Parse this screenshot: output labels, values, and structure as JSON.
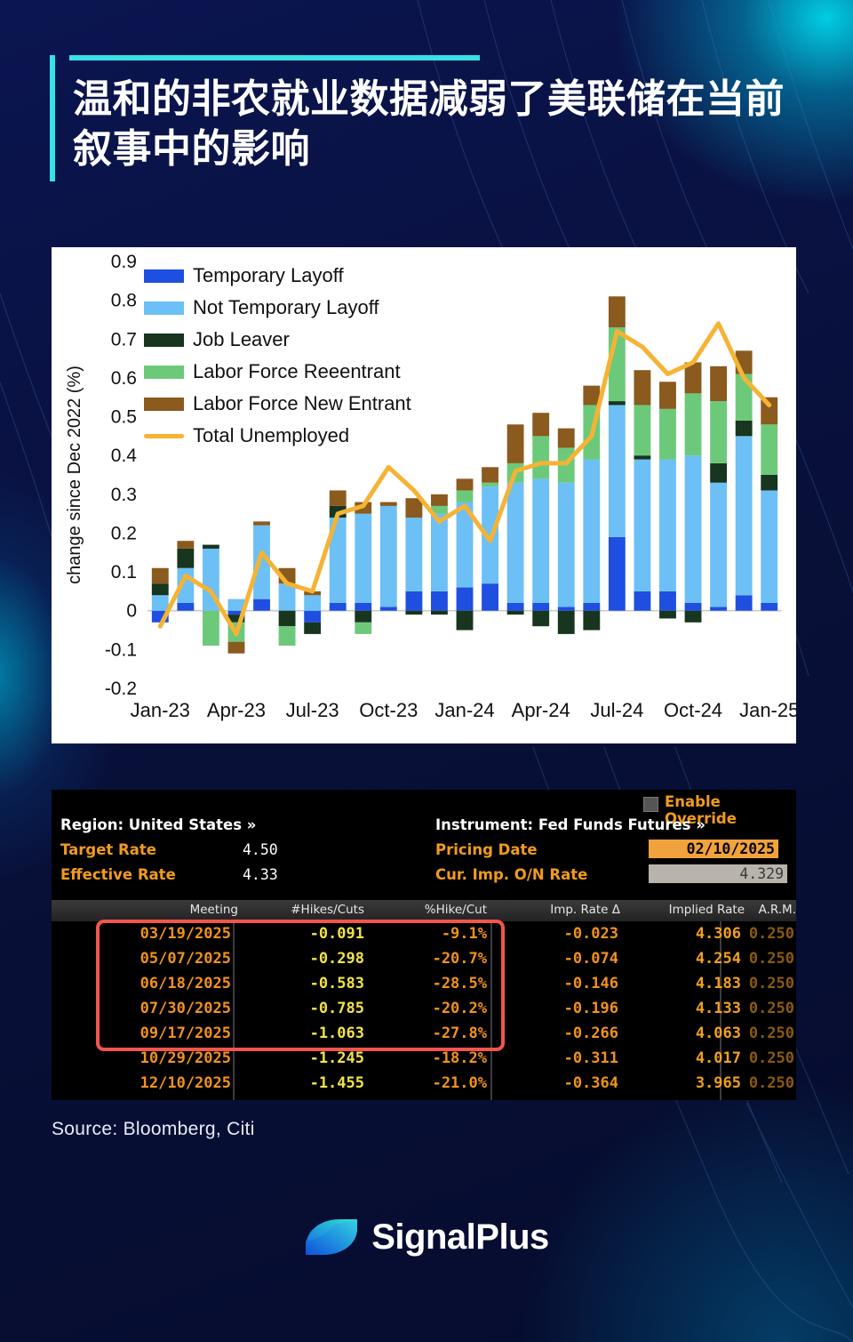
{
  "meta": {
    "brand": "SignalPlus",
    "accent_cyan": "#35e2e8",
    "bg_navy": "#0a1347"
  },
  "header": {
    "title": "温和的非农就业数据减弱了美联储在当前叙事中的影响"
  },
  "footer": {
    "source": "Source: Bloomberg, Citi",
    "logo_text": "SignalPlus"
  },
  "chart_data": {
    "type": "bar",
    "title": "",
    "xlabel": "",
    "ylabel": "change since Dec 2022 (%)",
    "ylim": [
      -0.2,
      0.9
    ],
    "ytick_labels": [
      "0.9",
      "0.8",
      "0.7",
      "0.6",
      "0.5",
      "0.4",
      "0.3",
      "0.2",
      "0.1",
      "0",
      "-0.1",
      "-0.2"
    ],
    "ytick_values": [
      0.9,
      0.8,
      0.7,
      0.6,
      0.5,
      0.4,
      0.3,
      0.2,
      0.1,
      0,
      -0.1,
      -0.2
    ],
    "grid": false,
    "stacked": true,
    "legend_position": "top-left",
    "xtick_labels": [
      "Jan-23",
      "Apr-23",
      "Jul-23",
      "Oct-23",
      "Jan-24",
      "Apr-24",
      "Jul-24",
      "Oct-24",
      "Jan-25"
    ],
    "xtick_indices": [
      0,
      3,
      6,
      9,
      12,
      15,
      18,
      21,
      24
    ],
    "categories": [
      "Jan-23",
      "Feb-23",
      "Mar-23",
      "Apr-23",
      "May-23",
      "Jun-23",
      "Jul-23",
      "Aug-23",
      "Sep-23",
      "Oct-23",
      "Nov-23",
      "Dec-23",
      "Jan-24",
      "Feb-24",
      "Mar-24",
      "Apr-24",
      "May-24",
      "Jun-24",
      "Jul-24",
      "Aug-24",
      "Sep-24",
      "Oct-24",
      "Nov-24",
      "Dec-24",
      "Jan-25"
    ],
    "colors": {
      "Temporary Layoff": "#1f4fe0",
      "Not Temporary Layoff": "#6cc0f5",
      "Job Leaver": "#17351f",
      "Labor Force Reeentrant": "#6dc97a",
      "Labor Force New Entrant": "#8a5a1e",
      "Total Unemployed": "#f5b335"
    },
    "series": [
      {
        "name": "Temporary Layoff",
        "values": [
          -0.03,
          0.02,
          0.0,
          -0.01,
          0.03,
          0.0,
          -0.03,
          0.02,
          0.02,
          0.01,
          0.05,
          0.05,
          0.06,
          0.07,
          0.02,
          0.02,
          0.01,
          0.02,
          0.19,
          0.05,
          0.05,
          0.02,
          0.01,
          0.04,
          0.02
        ]
      },
      {
        "name": "Not Temporary Layoff",
        "values": [
          0.04,
          0.09,
          0.16,
          0.03,
          0.19,
          0.07,
          0.04,
          0.22,
          0.23,
          0.26,
          0.19,
          0.2,
          0.22,
          0.25,
          0.31,
          0.32,
          0.32,
          0.37,
          0.34,
          0.34,
          0.34,
          0.38,
          0.32,
          0.41,
          0.29
        ]
      },
      {
        "name": "Job Leaver",
        "values": [
          0.03,
          0.05,
          0.01,
          -0.02,
          0.0,
          -0.04,
          -0.03,
          0.03,
          -0.03,
          0.0,
          -0.01,
          -0.01,
          -0.05,
          0.0,
          -0.01,
          -0.04,
          -0.06,
          -0.05,
          0.01,
          0.01,
          -0.02,
          -0.03,
          0.05,
          0.04,
          0.04
        ]
      },
      {
        "name": "Labor Force Reeentrant",
        "values": [
          0.0,
          0.0,
          -0.09,
          -0.05,
          0.0,
          -0.05,
          0.0,
          0.0,
          -0.03,
          0.0,
          0.0,
          0.02,
          0.03,
          0.01,
          0.05,
          0.11,
          0.09,
          0.14,
          0.19,
          0.13,
          0.13,
          0.16,
          0.16,
          0.12,
          0.13
        ]
      },
      {
        "name": "Labor Force New Entrant",
        "values": [
          0.04,
          0.02,
          0.0,
          -0.03,
          0.01,
          0.04,
          0.01,
          0.04,
          0.03,
          0.01,
          0.05,
          0.03,
          0.03,
          0.04,
          0.1,
          0.06,
          0.05,
          0.05,
          0.08,
          0.09,
          0.07,
          0.08,
          0.09,
          0.06,
          0.07
        ]
      }
    ],
    "line_series": {
      "name": "Total Unemployed",
      "values": [
        -0.04,
        0.09,
        0.05,
        -0.06,
        0.15,
        0.07,
        0.05,
        0.25,
        0.27,
        0.37,
        0.31,
        0.23,
        0.27,
        0.18,
        0.36,
        0.38,
        0.38,
        0.45,
        0.72,
        0.68,
        0.61,
        0.64,
        0.74,
        0.6,
        0.53
      ]
    }
  },
  "terminal": {
    "enable_override_label": "Enable Override",
    "region_label": "Region: United States »",
    "instrument_label": "Instrument: Fed Funds Futures »",
    "target_rate_label": "Target Rate",
    "target_rate_value": "4.50",
    "effective_rate_label": "Effective Rate",
    "effective_rate_value": "4.33",
    "pricing_date_label": "Pricing Date",
    "pricing_date_value": "02/10/2025",
    "cur_imp_on_label": "Cur. Imp. O/N Rate",
    "cur_imp_on_value": "4.329",
    "columns": [
      "Meeting",
      "#Hikes/Cuts",
      "%Hike/Cut",
      "Imp. Rate Δ",
      "Implied Rate",
      "A.R.M."
    ],
    "rows": [
      {
        "meeting": "03/19/2025",
        "hikes": "-0.091",
        "pct": "-9.1%",
        "imp_delta": "-0.023",
        "implied": "4.306",
        "arm": "0.250",
        "highlighted": true
      },
      {
        "meeting": "05/07/2025",
        "hikes": "-0.298",
        "pct": "-20.7%",
        "imp_delta": "-0.074",
        "implied": "4.254",
        "arm": "0.250",
        "highlighted": true
      },
      {
        "meeting": "06/18/2025",
        "hikes": "-0.583",
        "pct": "-28.5%",
        "imp_delta": "-0.146",
        "implied": "4.183",
        "arm": "0.250",
        "highlighted": true
      },
      {
        "meeting": "07/30/2025",
        "hikes": "-0.785",
        "pct": "-20.2%",
        "imp_delta": "-0.196",
        "implied": "4.133",
        "arm": "0.250",
        "highlighted": true
      },
      {
        "meeting": "09/17/2025",
        "hikes": "-1.063",
        "pct": "-27.8%",
        "imp_delta": "-0.266",
        "implied": "4.063",
        "arm": "0.250",
        "highlighted": true
      },
      {
        "meeting": "10/29/2025",
        "hikes": "-1.245",
        "pct": "-18.2%",
        "imp_delta": "-0.311",
        "implied": "4.017",
        "arm": "0.250",
        "highlighted": false
      },
      {
        "meeting": "12/10/2025",
        "hikes": "-1.455",
        "pct": "-21.0%",
        "imp_delta": "-0.364",
        "implied": "3.965",
        "arm": "0.250",
        "highlighted": false
      }
    ]
  }
}
